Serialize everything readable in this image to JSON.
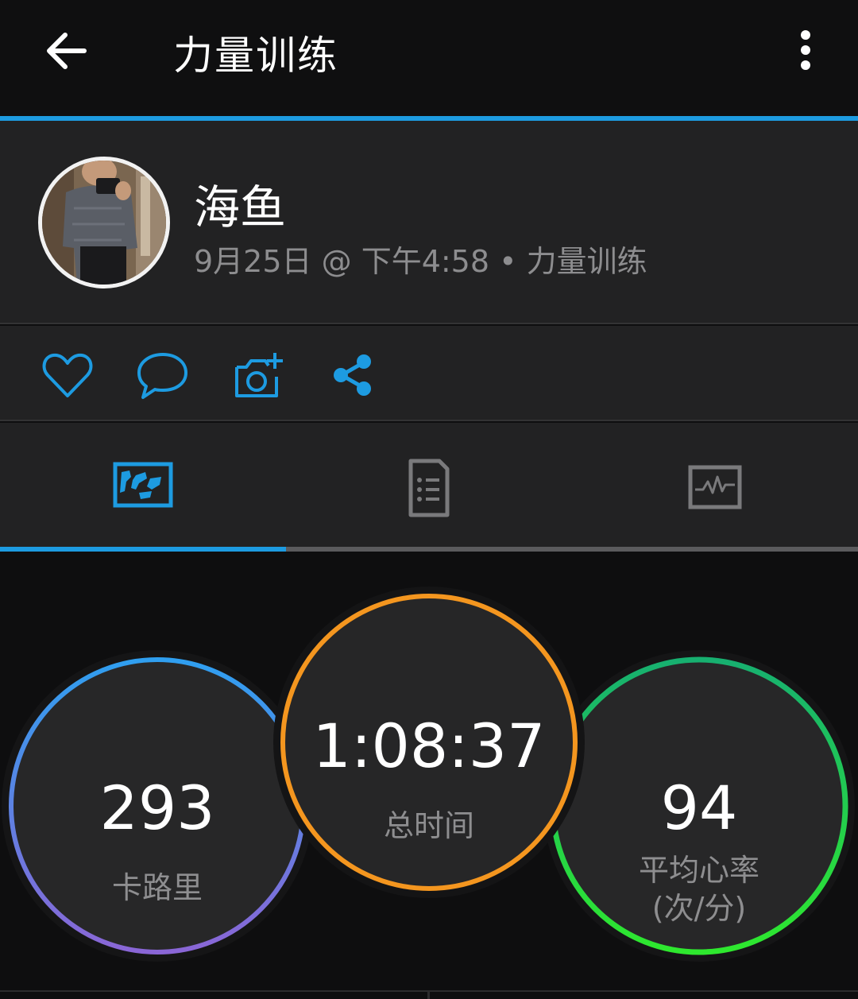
{
  "header": {
    "title": "力量训练",
    "back_icon": "arrow-left-icon",
    "more_icon": "more-vertical-icon"
  },
  "profile": {
    "name": "海鱼",
    "meta": "9月25日 @ 下午4:58 • 力量训练"
  },
  "social": {
    "icons": [
      "heart-icon",
      "comment-icon",
      "add-photo-icon",
      "share-icon"
    ]
  },
  "tabs": {
    "icons": [
      "map-icon",
      "details-icon",
      "chart-icon"
    ],
    "selected": 0
  },
  "stats": [
    {
      "value": "293",
      "label": "卡路里",
      "label2": ""
    },
    {
      "value": "1:08:37",
      "label": "总时间",
      "label2": ""
    },
    {
      "value": "94",
      "label": "平均心率",
      "label2": "(次/分)"
    }
  ],
  "colors": {
    "accent": "#1d9be1",
    "calories_ring": [
      "#2f9ff0",
      "#8a66d6"
    ],
    "time_ring": "#f4961f",
    "heart_ring": [
      "#17b070",
      "#2ee82e"
    ]
  }
}
